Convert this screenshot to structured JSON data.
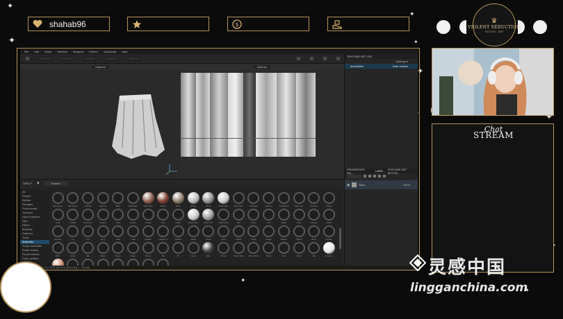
{
  "stats": [
    {
      "icon": "heart-icon",
      "value": "shahab96"
    },
    {
      "icon": "star-icon",
      "value": ""
    },
    {
      "icon": "dollar-coin-icon",
      "value": ""
    },
    {
      "icon": "gift-hand-icon",
      "value": ""
    }
  ],
  "badge": {
    "title": "VIOLENT SEDUCTION",
    "subtitle": "TATTOO · ART"
  },
  "chat": {
    "line1": "Chat",
    "line2": "STREAM"
  },
  "app": {
    "menu": [
      "File",
      "Edit",
      "Mode",
      "Window",
      "Viewport",
      "Python",
      "JavaScript",
      "Help"
    ],
    "viewport_3d_label": "Material",
    "viewport_2d_label": "Material",
    "texture_set_list_title": "TEXTURE SET LIST",
    "settings_label": "Settings ▾",
    "texture_set_name": "defaultMat",
    "main_shader": "Main shader",
    "properties_tabs": [
      "PROPERTIES - PAI...",
      "LAYE...",
      "TEXTURE SET SETTIN..."
    ],
    "layer_name": "Base",
    "layer_blend": "Norm",
    "shelf_title": "SHELF",
    "shelf_search": "Search",
    "categories": [
      "All",
      "Project",
      "Alphas",
      "Grunges",
      "Procedurals",
      "Textures",
      "Hard Surfaces",
      "Skin",
      "Filters",
      "Brushes",
      "Particles",
      "Tools",
      "Materials",
      "Smart materials",
      "Smart masks",
      "Environments",
      "Color profiles"
    ],
    "selected_category": "Materials",
    "materials": [
      "Aluminium",
      "Aluminium",
      "Artificial",
      "Autumn",
      "Bark",
      "Bark Mos",
      "Bark Pine",
      "Black",
      "Bone",
      "Brass",
      "Brick",
      "Brick Bas",
      "Brick Old",
      "Calf Skin",
      "Carbon",
      "Cardboard",
      "Cast Iron",
      "Ceramic",
      "Chain",
      "Coal",
      "Cobalt",
      "Concrete",
      "Copper",
      "Cork",
      "Cotton",
      "Cream",
      "Dirt",
      "Fabric",
      "Fabric Den",
      "Fabric Kni",
      "Fabric Rou",
      "Felt",
      "Foam",
      "Fur",
      "Glass",
      "Gold",
      "Granite",
      "Grass",
      "Ground",
      "Ice",
      "Iron",
      "Ivory",
      "Jade",
      "Lava",
      "Leather",
      "Leather Fi",
      "Marble",
      "Metal",
      "Moss",
      "Mud",
      "Nickel",
      "Paint",
      "Paper",
      "Plaster",
      "Plastic",
      "Rock",
      "Rubber",
      "Rust",
      "Sand",
      "Silk",
      "Silver",
      "Snow",
      "Steel",
      "Stone",
      "Tile",
      "Tin",
      "Velvet",
      "Wax",
      "Wood",
      "Wood Oak",
      "Wood Pine",
      "Wool",
      "Zinc",
      "Cloth",
      "Clay",
      "Chrome",
      "Emerald",
      "Enamel",
      "Flesh",
      "Skin",
      "Pearl",
      "Mustard",
      "Olive",
      "Coral"
    ],
    "status_text": "[GPU] 7.93GB / 14.70GB (53.9%) [Render] — Ready"
  },
  "watermark": {
    "chinese": "灵感中国",
    "url": "lingganchina.com"
  },
  "colors": {
    "gold": "#b8955e",
    "background": "#0b0b0b"
  }
}
